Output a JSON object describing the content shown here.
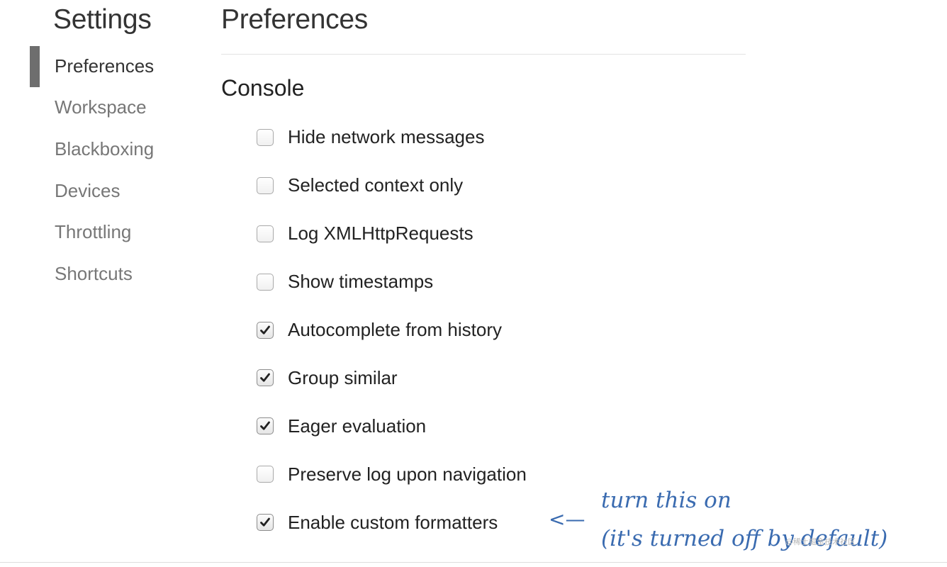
{
  "sidebar": {
    "title": "Settings",
    "items": [
      {
        "label": "Preferences",
        "active": true
      },
      {
        "label": "Workspace",
        "active": false
      },
      {
        "label": "Blackboxing",
        "active": false
      },
      {
        "label": "Devices",
        "active": false
      },
      {
        "label": "Throttling",
        "active": false
      },
      {
        "label": "Shortcuts",
        "active": false
      }
    ]
  },
  "main": {
    "title": "Preferences",
    "section": "Console",
    "options": [
      {
        "label": "Hide network messages",
        "checked": false
      },
      {
        "label": "Selected context only",
        "checked": false
      },
      {
        "label": "Log XMLHttpRequests",
        "checked": false
      },
      {
        "label": "Show timestamps",
        "checked": false
      },
      {
        "label": "Autocomplete from history",
        "checked": true
      },
      {
        "label": "Group similar",
        "checked": true
      },
      {
        "label": "Eager evaluation",
        "checked": true
      },
      {
        "label": "Preserve log upon navigation",
        "checked": false
      },
      {
        "label": "Enable custom formatters",
        "checked": true
      }
    ]
  },
  "annotation": {
    "arrow": "<—",
    "line1": "turn this on",
    "line2": "(it's turned off by default)",
    "color": "#3a6bb0"
  },
  "watermark": "@稀土掘金技术社区"
}
